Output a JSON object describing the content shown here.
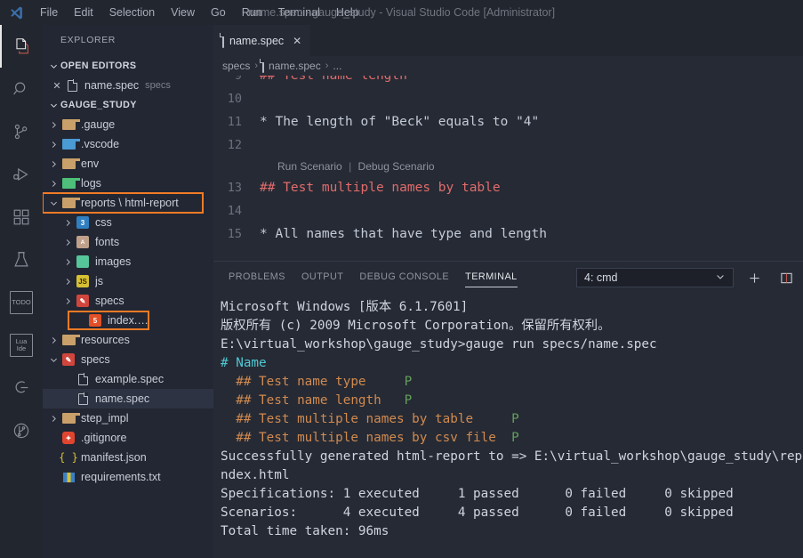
{
  "window": {
    "title": "name.spec - gauge_study - Visual Studio Code [Administrator]",
    "logo_icon": "vscode-logo-icon"
  },
  "menubar": {
    "items": [
      {
        "label": "File"
      },
      {
        "label": "Edit"
      },
      {
        "label": "Selection"
      },
      {
        "label": "View"
      },
      {
        "label": "Go"
      },
      {
        "label": "Run"
      },
      {
        "label": "Terminal"
      },
      {
        "label": "Help"
      }
    ]
  },
  "activitybar": {
    "items": [
      {
        "name": "explorer",
        "icon": "files-icon",
        "active": true
      },
      {
        "name": "search",
        "icon": "search-icon",
        "active": false
      },
      {
        "name": "source-control",
        "icon": "source-control-icon",
        "active": false
      },
      {
        "name": "run-and-debug",
        "icon": "run-debug-icon",
        "active": false
      },
      {
        "name": "extensions",
        "icon": "extensions-icon",
        "active": false
      },
      {
        "name": "testing",
        "icon": "beaker-icon",
        "active": false
      },
      {
        "name": "todo",
        "icon": "todo-icon",
        "label": "TODO",
        "active": false
      },
      {
        "name": "lua-ide",
        "icon": "lua-ide-icon",
        "label": "Lua Ide",
        "active": false
      },
      {
        "name": "gauge",
        "icon": "gauge-icon",
        "active": false
      },
      {
        "name": "git-graph",
        "icon": "git-graph-icon",
        "active": false
      }
    ]
  },
  "sidebar": {
    "title": "EXPLORER",
    "open_editors": {
      "label": "OPEN EDITORS",
      "expanded": true,
      "items": [
        {
          "name": "name.spec",
          "sub": "specs",
          "icon": "file-icon",
          "close": "✕"
        }
      ]
    },
    "project": {
      "label": "GAUGE_STUDY",
      "expanded": true,
      "tree": [
        {
          "label": ".gauge",
          "depth": 1,
          "type": "folder",
          "icon": "folder-icon",
          "state": "collapsed",
          "highlight": false
        },
        {
          "label": ".vscode",
          "depth": 1,
          "type": "folder",
          "icon": "vscode-folder-icon",
          "state": "collapsed",
          "highlight": false
        },
        {
          "label": "env",
          "depth": 1,
          "type": "folder",
          "icon": "folder-icon",
          "state": "collapsed",
          "highlight": false
        },
        {
          "label": "logs",
          "depth": 1,
          "type": "folder",
          "icon": "logs-folder-icon",
          "state": "collapsed",
          "highlight": false
        },
        {
          "label": "reports \\ html-report",
          "depth": 1,
          "type": "folder",
          "icon": "folder-open-icon",
          "state": "expanded",
          "highlight": true
        },
        {
          "label": "css",
          "depth": 2,
          "type": "folder",
          "icon": "css-folder-icon",
          "state": "collapsed",
          "highlight": false
        },
        {
          "label": "fonts",
          "depth": 2,
          "type": "folder",
          "icon": "fonts-folder-icon",
          "state": "collapsed",
          "highlight": false
        },
        {
          "label": "images",
          "depth": 2,
          "type": "folder",
          "icon": "images-folder-icon",
          "state": "collapsed",
          "highlight": false
        },
        {
          "label": "js",
          "depth": 2,
          "type": "folder",
          "icon": "js-folder-icon",
          "state": "collapsed",
          "highlight": false
        },
        {
          "label": "specs",
          "depth": 2,
          "type": "folder",
          "icon": "specs-folder-icon",
          "state": "collapsed",
          "highlight": false
        },
        {
          "label": "index.html",
          "depth": 2,
          "type": "file",
          "icon": "html5-icon",
          "state": "none",
          "highlight": true
        },
        {
          "label": "resources",
          "depth": 1,
          "type": "folder",
          "icon": "folder-icon",
          "state": "collapsed",
          "highlight": false
        },
        {
          "label": "specs",
          "depth": 1,
          "type": "folder",
          "icon": "specs-folder-icon",
          "state": "expanded",
          "highlight": false
        },
        {
          "label": "example.spec",
          "depth": 2,
          "type": "file",
          "icon": "file-icon",
          "state": "none",
          "highlight": false
        },
        {
          "label": "name.spec",
          "depth": 2,
          "type": "file",
          "icon": "file-icon",
          "state": "none",
          "highlight": false,
          "selected": true
        },
        {
          "label": "step_impl",
          "depth": 1,
          "type": "folder",
          "icon": "folder-icon",
          "state": "collapsed",
          "highlight": false
        },
        {
          "label": ".gitignore",
          "depth": 1,
          "type": "file",
          "icon": "git-icon",
          "state": "none",
          "highlight": false
        },
        {
          "label": "manifest.json",
          "depth": 1,
          "type": "file",
          "icon": "json-icon",
          "state": "none",
          "highlight": false
        },
        {
          "label": "requirements.txt",
          "depth": 1,
          "type": "file",
          "icon": "requirements-icon",
          "state": "none",
          "highlight": false
        }
      ]
    }
  },
  "editor": {
    "tab": {
      "label": "name.spec",
      "icon": "file-icon",
      "close": "✕"
    },
    "breadcrumb": {
      "parts": [
        "specs",
        "name.spec",
        "..."
      ],
      "icon": "file-icon",
      "separator": "›"
    },
    "lines": [
      {
        "no": "9",
        "text": "## Test name length",
        "kind": "heading"
      },
      {
        "no": "10",
        "text": "",
        "kind": "blank"
      },
      {
        "no": "11",
        "text": "* The length of \"Beck\" equals to \"4\"",
        "kind": "step"
      },
      {
        "no": "12",
        "text": "",
        "kind": "blank"
      }
    ],
    "codelens": {
      "run": "Run Scenario",
      "bar": "|",
      "debug": "Debug Scenario"
    },
    "lines2": [
      {
        "no": "13",
        "text": "## Test multiple names by table",
        "kind": "heading"
      },
      {
        "no": "14",
        "text": "",
        "kind": "blank"
      },
      {
        "no": "15",
        "text": "* All names that have type and length",
        "kind": "step"
      }
    ]
  },
  "panel": {
    "tabs": [
      {
        "label": "PROBLEMS",
        "active": false
      },
      {
        "label": "OUTPUT",
        "active": false
      },
      {
        "label": "DEBUG CONSOLE",
        "active": false
      },
      {
        "label": "TERMINAL",
        "active": true
      }
    ],
    "terminal_select": {
      "value": "4: cmd",
      "chevron": "chevron-down-icon"
    },
    "new_terminal": "+",
    "split_terminal": "split-terminal-icon",
    "terminal_lines": [
      {
        "segments": [
          {
            "t": "Microsoft Windows [版本 6.1.7601]",
            "c": "plain"
          }
        ]
      },
      {
        "segments": [
          {
            "t": "版权所有 (c) 2009 Microsoft Corporation。保留所有权利。",
            "c": "plain"
          }
        ]
      },
      {
        "segments": [
          {
            "t": "",
            "c": "plain"
          }
        ]
      },
      {
        "segments": [
          {
            "t": "E:\\virtual_workshop\\gauge_study>gauge run specs/name.spec",
            "c": "plain"
          }
        ]
      },
      {
        "segments": [
          {
            "t": "# Name",
            "c": "cyan"
          }
        ]
      },
      {
        "segments": [
          {
            "t": "  ## Test name type     ",
            "c": "orange"
          },
          {
            "t": "P",
            "c": "green"
          }
        ]
      },
      {
        "segments": [
          {
            "t": "  ## Test name length   ",
            "c": "orange"
          },
          {
            "t": "P",
            "c": "green"
          }
        ]
      },
      {
        "segments": [
          {
            "t": "  ## Test multiple names by table     ",
            "c": "orange"
          },
          {
            "t": "P",
            "c": "green"
          }
        ]
      },
      {
        "segments": [
          {
            "t": "  ## Test multiple names by csv file  ",
            "c": "orange"
          },
          {
            "t": "P",
            "c": "green"
          }
        ]
      },
      {
        "segments": [
          {
            "t": "",
            "c": "plain"
          }
        ]
      },
      {
        "segments": [
          {
            "t": "Successfully generated html-report to => E:\\virtual_workshop\\gauge_study\\reports\\i",
            "c": "plain"
          }
        ]
      },
      {
        "segments": [
          {
            "t": "ndex.html",
            "c": "plain"
          }
        ]
      },
      {
        "segments": [
          {
            "t": "Specifications: 1 executed     1 passed      0 failed     0 skipped",
            "c": "plain"
          }
        ]
      },
      {
        "segments": [
          {
            "t": "Scenarios:      4 executed     4 passed      0 failed     0 skipped",
            "c": "plain"
          }
        ]
      },
      {
        "segments": [
          {
            "t": "",
            "c": "plain"
          }
        ]
      },
      {
        "segments": [
          {
            "t": "Total time taken: 96ms",
            "c": "plain"
          }
        ]
      }
    ]
  },
  "colors": {
    "accent_highlight": "#f07b26",
    "editor_bg": "#262a34",
    "sidebar_bg": "#232733",
    "chrome_bg": "#22262f",
    "terminal_green": "#63a05c",
    "terminal_orange": "#d08a50",
    "terminal_cyan": "#4ec9d4",
    "heading_red": "#e06c6c"
  }
}
